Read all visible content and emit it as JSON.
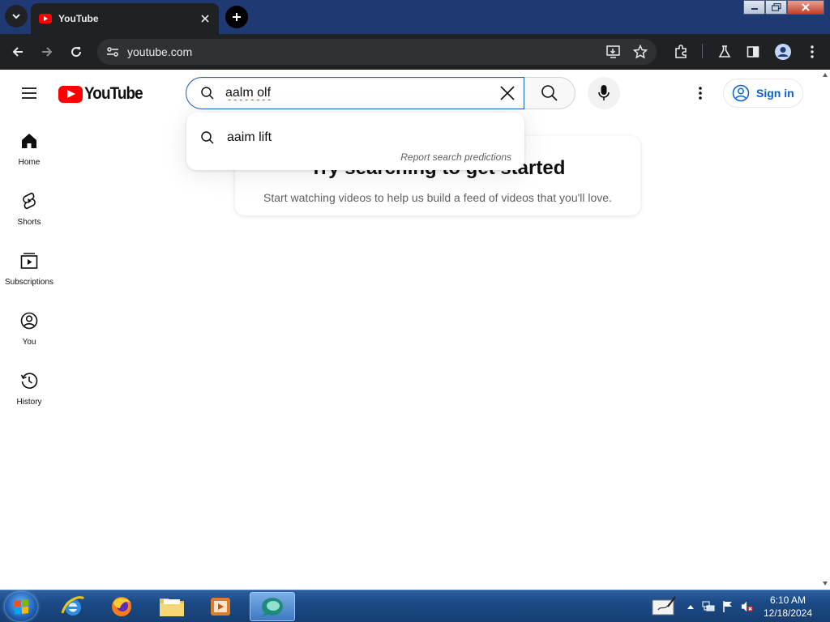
{
  "browser": {
    "tab_title": "YouTube",
    "url": "youtube.com"
  },
  "youtube": {
    "logo_text": "YouTube",
    "search": {
      "query": "aalm olf",
      "suggestions": [
        "aaim lift"
      ],
      "report_label": "Report search predictions"
    },
    "signin_label": "Sign in",
    "sidebar": {
      "items": [
        {
          "label": "Home",
          "icon": "home-icon"
        },
        {
          "label": "Shorts",
          "icon": "shorts-icon"
        },
        {
          "label": "Subscriptions",
          "icon": "subscriptions-icon"
        },
        {
          "label": "You",
          "icon": "you-icon"
        },
        {
          "label": "History",
          "icon": "history-icon"
        }
      ]
    },
    "empty_state": {
      "heading": "Try searching to get started",
      "body": "Start watching videos to help us build a feed of videos that you'll love."
    },
    "colors": {
      "brand_red": "#ff0000",
      "link_blue": "#065fd4",
      "focus_blue": "#1c62b9"
    }
  },
  "taskbar": {
    "apps": [
      "internet-explorer",
      "firefox",
      "file-explorer",
      "media-player",
      "active-app"
    ],
    "clock": {
      "time": "6:10 AM",
      "date": "12/18/2024"
    }
  }
}
